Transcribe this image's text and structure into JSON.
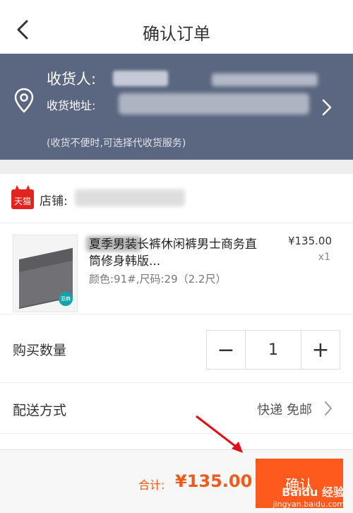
{
  "navbar": {
    "title": "确认订单"
  },
  "address": {
    "receiver_label": "收货人:",
    "address_label": "收货地址:",
    "note": "(收货不便时,可选择代收货服务)"
  },
  "shop": {
    "badge": "天猫",
    "label": "店铺:"
  },
  "product": {
    "title": "夏季男装长裤休闲裤男士商务直筒修身韩版...",
    "sku": "颜色:91#,尺码:29（2.2尺）",
    "price": "¥135.00",
    "quantity": "x1",
    "thumb_tag": "亚麻"
  },
  "quantity_row": {
    "label": "购买数量",
    "minus": "−",
    "value": "1",
    "plus": "+"
  },
  "shipping_row": {
    "label": "配送方式",
    "value": "快递 免邮"
  },
  "footer": {
    "total_label": "合计:",
    "total_value": "¥135.00",
    "confirm_label": "确认"
  },
  "watermark": {
    "main": "Baidu 经验",
    "sub": "jingyan.baidu.com"
  },
  "colors": {
    "header_bg": "#5b6780",
    "accent": "#ff5a1e",
    "price": "#f05a1a"
  }
}
